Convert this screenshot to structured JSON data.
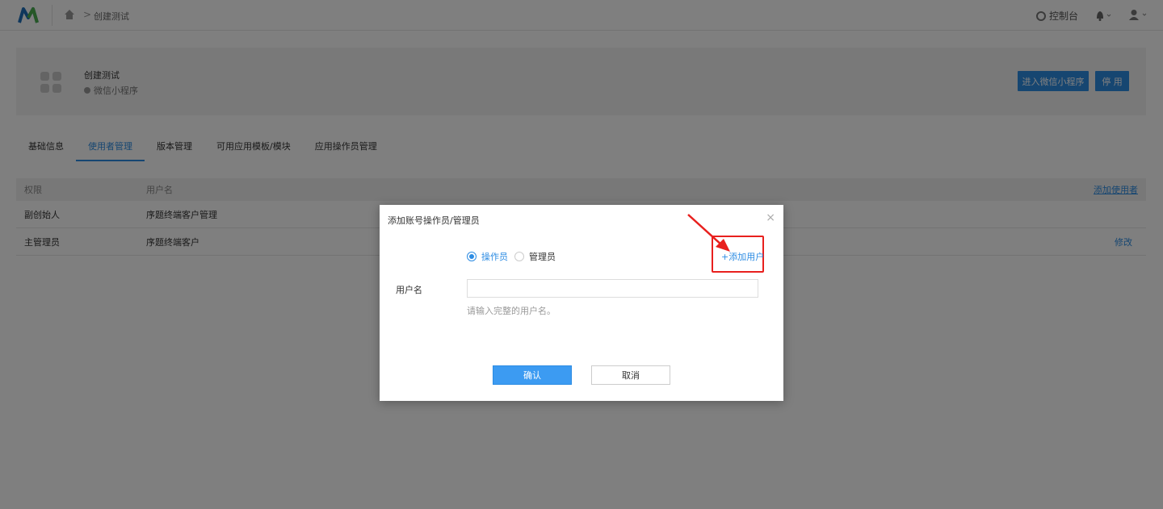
{
  "topbar": {
    "breadcrumb_current": "创建测试",
    "breadcrumb_separator": ">",
    "console_label": "控制台",
    "icons": [
      "logo-icon",
      "home-icon",
      "gear-icon",
      "bell-icon",
      "user-icon"
    ]
  },
  "app": {
    "name": "创建测试",
    "type": "微信小程序",
    "enter_button": "进入微信小程序",
    "disable_button": "停 用"
  },
  "tabs": [
    {
      "label": "基础信息",
      "active": false
    },
    {
      "label": "使用者管理",
      "active": true
    },
    {
      "label": "版本管理",
      "active": false
    },
    {
      "label": "可用应用模板/模块",
      "active": false
    },
    {
      "label": "应用操作员管理",
      "active": false
    }
  ],
  "table": {
    "headers": [
      "权限",
      "用户名"
    ],
    "add_user_link": "添加使用者",
    "rows": [
      {
        "role": "副创始人",
        "username": "序题终端客户管理",
        "action": ""
      },
      {
        "role": "主管理员",
        "username": "序题终端客户",
        "action": "修改"
      }
    ]
  },
  "modal": {
    "title": "添加账号操作员/管理员",
    "close": "×",
    "radio_operator": "操作员",
    "radio_admin": "管理员",
    "selected": "操作员",
    "add_user_button": "+添加用户",
    "username_label": "用户名",
    "username_value": "",
    "username_hint": "请输入完整的用户名。",
    "confirm_button": "确认",
    "cancel_button": "取消"
  },
  "colors": {
    "accent": "#2d8ce3",
    "annotation": "#e8201e",
    "overlay": "rgba(0,0,0,0.5)"
  }
}
